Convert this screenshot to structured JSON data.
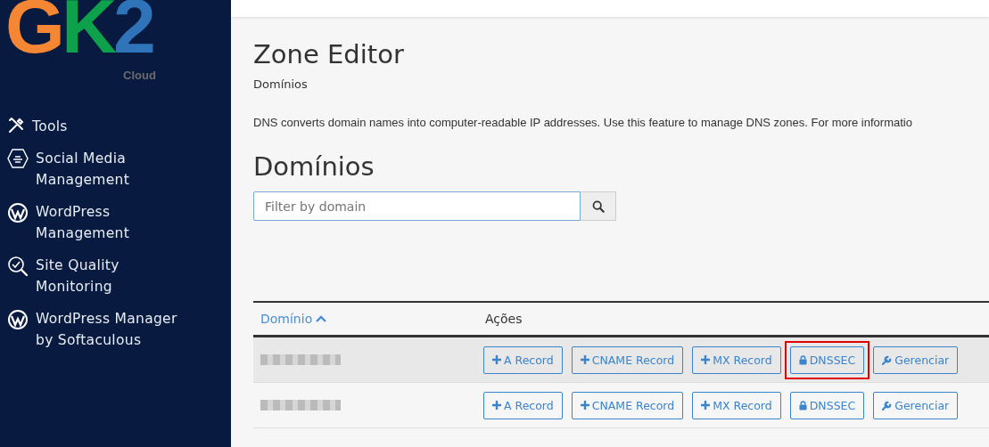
{
  "logo": {
    "letters": [
      {
        "text": "G",
        "color": "#f58634"
      },
      {
        "text": "K",
        "color": "#0ea14b"
      },
      {
        "text": "2",
        "color": "#2f73b9"
      }
    ],
    "subtitle": "Cloud"
  },
  "sidebar": {
    "items": [
      {
        "label": "Tools",
        "kind": "tools"
      },
      {
        "label": "Social Media Management",
        "kind": "social"
      },
      {
        "label": "WordPress Management",
        "kind": "wordpress"
      },
      {
        "label": "Site Quality Monitoring",
        "kind": "monitor"
      },
      {
        "label": "WordPress Manager by Softaculous",
        "kind": "wordpress"
      }
    ]
  },
  "page": {
    "title": "Zone Editor",
    "breadcrumb": "Domínios",
    "description": "DNS converts domain names into computer-readable IP addresses. Use this feature to manage DNS zones. For more informatio"
  },
  "section": {
    "title": "Domínios",
    "search": {
      "placeholder": "Filter by domain"
    }
  },
  "table": {
    "columns": [
      {
        "label": "Domínio",
        "sorted": true
      },
      {
        "label": "Ações",
        "sorted": false
      }
    ],
    "rows": [
      {
        "hovered": true,
        "actions": [
          {
            "label": "A Record",
            "kind": "add",
            "highlighted": false
          },
          {
            "label": "CNAME Record",
            "kind": "add",
            "highlighted": false
          },
          {
            "label": "MX Record",
            "kind": "add",
            "highlighted": false
          },
          {
            "label": "DNSSEC",
            "kind": "dnssec",
            "highlighted": true
          },
          {
            "label": "Gerenciar",
            "kind": "manage",
            "highlighted": false
          }
        ]
      },
      {
        "hovered": false,
        "actions": [
          {
            "label": "A Record",
            "kind": "add",
            "highlighted": false
          },
          {
            "label": "CNAME Record",
            "kind": "add",
            "highlighted": false
          },
          {
            "label": "MX Record",
            "kind": "add",
            "highlighted": false
          },
          {
            "label": "DNSSEC",
            "kind": "dnssec",
            "highlighted": false
          },
          {
            "label": "Gerenciar",
            "kind": "manage",
            "highlighted": false
          }
        ]
      }
    ]
  }
}
